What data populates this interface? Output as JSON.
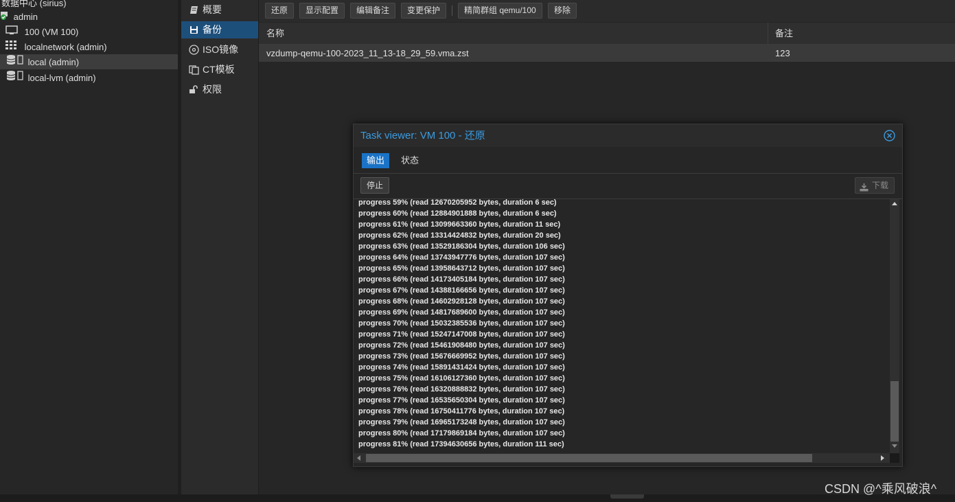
{
  "tree": {
    "datacenter": "数据中心 (sirius)",
    "node": "admin",
    "vm": "100 (VM 100)",
    "network": "localnetwork (admin)",
    "local": "local (admin)",
    "local_lvm": "local-lvm (admin)"
  },
  "nav": {
    "summary": "概要",
    "backup": "备份",
    "iso": "ISO镜像",
    "ct": "CT模板",
    "permissions": "权限"
  },
  "toolbar": {
    "restore": "还原",
    "show_config": "显示配置",
    "edit_notes": "编辑备注",
    "change_protection": "变更保护",
    "prune": "精简群组 qemu/100",
    "remove": "移除"
  },
  "grid": {
    "col_name": "名称",
    "col_notes": "备注",
    "rows": [
      {
        "name": "vzdump-qemu-100-2023_11_13-18_29_59.vma.zst",
        "notes": "123"
      }
    ]
  },
  "modal": {
    "title": "Task viewer: VM 100 - 还原",
    "tab_output": "输出",
    "tab_status": "状态",
    "stop": "停止",
    "download": "下载",
    "log": [
      "progress 59% (read 12670205952 bytes, duration 6 sec)",
      "progress 60% (read 12884901888 bytes, duration 6 sec)",
      "progress 61% (read 13099663360 bytes, duration 11 sec)",
      "progress 62% (read 13314424832 bytes, duration 20 sec)",
      "progress 63% (read 13529186304 bytes, duration 106 sec)",
      "progress 64% (read 13743947776 bytes, duration 107 sec)",
      "progress 65% (read 13958643712 bytes, duration 107 sec)",
      "progress 66% (read 14173405184 bytes, duration 107 sec)",
      "progress 67% (read 14388166656 bytes, duration 107 sec)",
      "progress 68% (read 14602928128 bytes, duration 107 sec)",
      "progress 69% (read 14817689600 bytes, duration 107 sec)",
      "progress 70% (read 15032385536 bytes, duration 107 sec)",
      "progress 71% (read 15247147008 bytes, duration 107 sec)",
      "progress 72% (read 15461908480 bytes, duration 107 sec)",
      "progress 73% (read 15676669952 bytes, duration 107 sec)",
      "progress 74% (read 15891431424 bytes, duration 107 sec)",
      "progress 75% (read 16106127360 bytes, duration 107 sec)",
      "progress 76% (read 16320888832 bytes, duration 107 sec)",
      "progress 77% (read 16535650304 bytes, duration 107 sec)",
      "progress 78% (read 16750411776 bytes, duration 107 sec)",
      "progress 79% (read 16965173248 bytes, duration 107 sec)",
      "progress 80% (read 17179869184 bytes, duration 107 sec)",
      "progress 81% (read 17394630656 bytes, duration 111 sec)"
    ]
  },
  "watermark": "CSDN @^乘风破浪^",
  "colors": {
    "accent": "#1a73c6",
    "title_blue": "#3a9be0",
    "status_ok": "#2ea043"
  }
}
